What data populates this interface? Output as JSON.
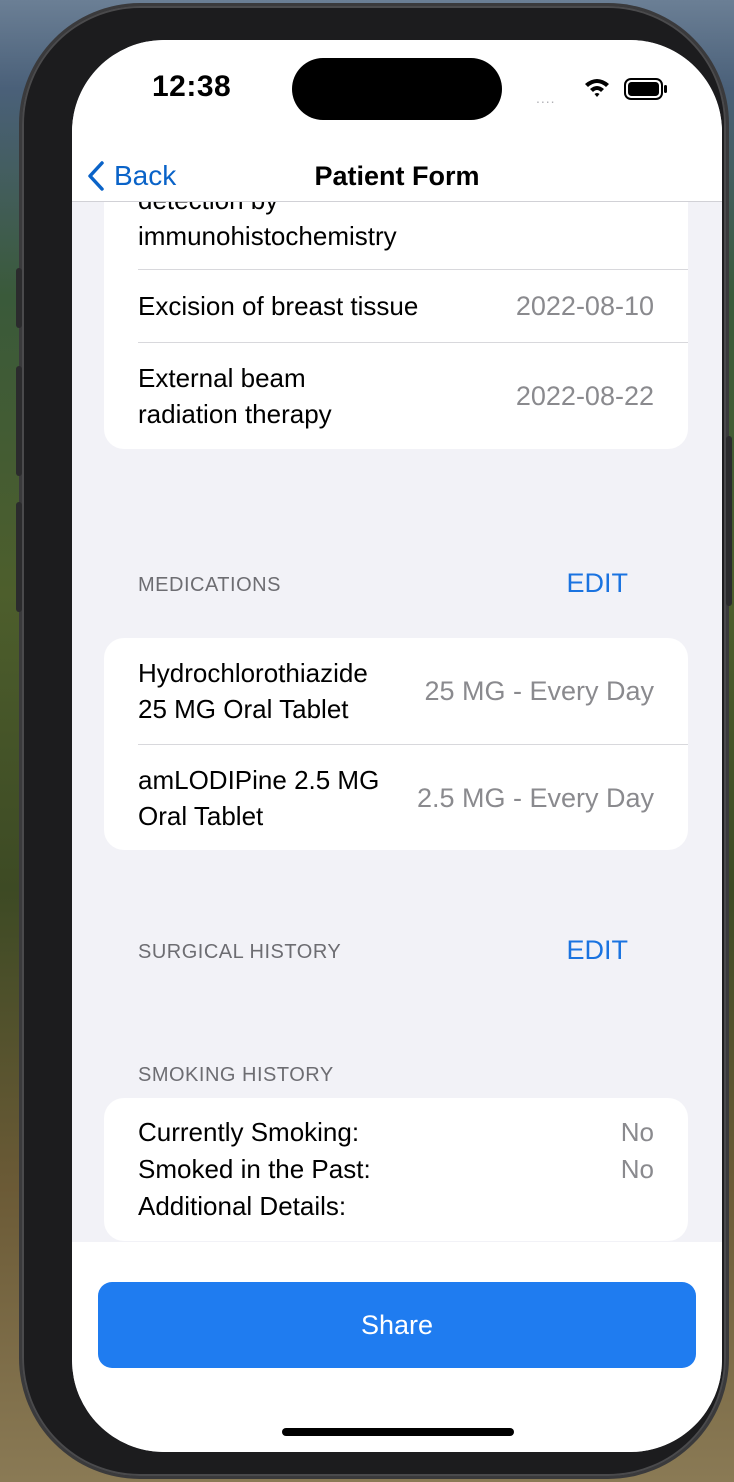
{
  "status": {
    "time": "12:38",
    "signal": "...."
  },
  "nav": {
    "back_label": "Back",
    "title": "Patient Form"
  },
  "procedures": {
    "rows": [
      {
        "title": "detection by\nimmunohistochemistry",
        "value": ""
      },
      {
        "title": "Excision of breast tissue",
        "value": "2022-08-10"
      },
      {
        "title": "External beam\nradiation therapy",
        "value": "2022-08-22"
      }
    ]
  },
  "medications": {
    "header": "MEDICATIONS",
    "edit_label": "EDIT",
    "rows": [
      {
        "title": "Hydrochlorothiazide\n25 MG Oral Tablet",
        "value": "25 MG - Every Day"
      },
      {
        "title": "amLODIPine 2.5 MG\nOral Tablet",
        "value": "2.5 MG - Every Day"
      }
    ]
  },
  "surgical_history": {
    "header": "SURGICAL HISTORY",
    "edit_label": "EDIT"
  },
  "smoking_history": {
    "header": "SMOKING HISTORY",
    "currently_label": "Currently Smoking:",
    "currently_value": "No",
    "past_label": "Smoked in the Past:",
    "past_value": "No",
    "details_label": "Additional Details:"
  },
  "share_label": "Share",
  "colors": {
    "accent": "#1f7cf0",
    "link": "#0a63c8",
    "background": "#f2f2f7"
  }
}
